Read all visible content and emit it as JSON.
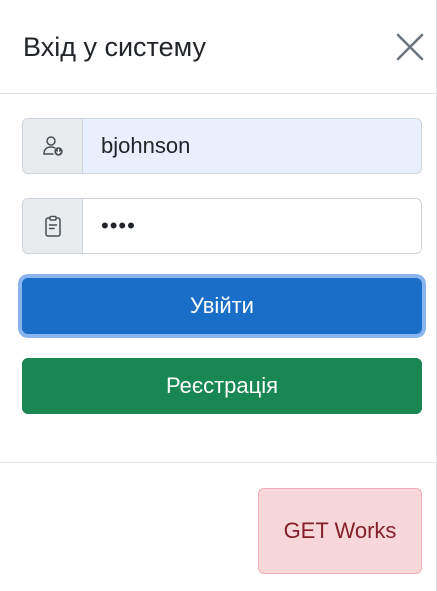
{
  "modal": {
    "title": "Вхід у систему"
  },
  "form": {
    "username": {
      "value": "bjohnson",
      "icon": "user-icon"
    },
    "password": {
      "value": "••••",
      "icon": "clipboard-icon"
    },
    "login_label": "Увійти",
    "register_label": "Реєстрація"
  },
  "footer": {
    "status_label": "GET Works"
  },
  "colors": {
    "primary": "#1a6ec8",
    "success": "#198754",
    "danger_bg": "#f8d7da",
    "danger_text": "#842029",
    "autofill_bg": "#e8f0fe"
  }
}
